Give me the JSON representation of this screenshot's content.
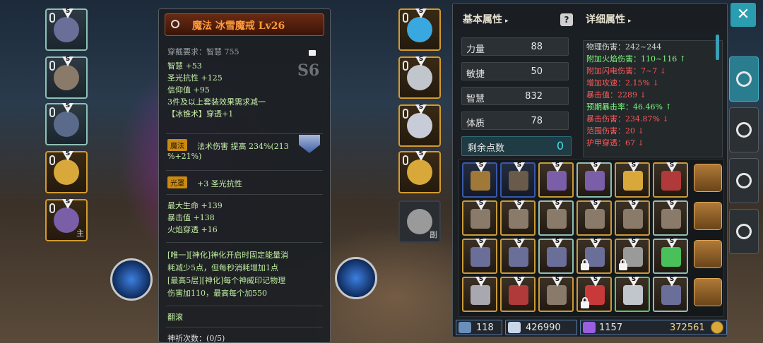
{
  "colors": {
    "accent": "#2a9db1",
    "item_green": "#c7f0a8",
    "stat_red": "#ff5a5a",
    "stat_green": "#7dff7d",
    "gold_tag": "#c98a10",
    "title_orange": "#ff9a3a"
  },
  "left_column": [
    {
      "icon": "helmet-icon",
      "rarity": "teal",
      "badge": "S"
    },
    {
      "icon": "armor-icon",
      "rarity": "teal",
      "badge": "S"
    },
    {
      "icon": "robe-icon",
      "rarity": "teal",
      "badge": "S"
    },
    {
      "icon": "ring-icon",
      "rarity": "gold",
      "badge": "S"
    },
    {
      "icon": "staff-icon",
      "rarity": "gold",
      "badge": "S",
      "sub": "主"
    }
  ],
  "tooltip": {
    "title": "魔法 冰雪魔戒 Lv26",
    "requirement": "穿戴要求：智慧 755",
    "grade": "S6",
    "base_lines": [
      "智慧 +53",
      "圣光抗性 +125",
      "信仰值 +95",
      "3件及以上套装效果需求减一",
      "【冰锥术】穿透+1"
    ],
    "tag_magic": "魔法",
    "magic_text": "法术伤害 提高 234%(213",
    "magic_text2": "%+21%)",
    "tag_light": "光罩",
    "light_text": "+3 圣光抗性",
    "bonus_lines": [
      "最大生命 +139",
      "暴击值 +138",
      "火焰穿透 +16"
    ],
    "unique_lines": [
      "[唯一][神化]神化开启时固定能量消",
      "耗减少5点，但每秒消耗增加1点",
      "[最高5层][神化]每个神威印记物理",
      "伤害加110，最高每个加550"
    ],
    "roll_label": "翻滚",
    "pray_label": "神祈次数：(0/5)"
  },
  "right_column": [
    {
      "icon": "necklace-icon",
      "badge": "S"
    },
    {
      "icon": "gloves-icon",
      "badge": "S"
    },
    {
      "icon": "boots-icon",
      "badge": "S"
    },
    {
      "icon": "ring-icon",
      "badge": "S"
    },
    {
      "icon": "sword-icon",
      "sub": "副"
    }
  ],
  "stats": {
    "basic_header": "基本属性",
    "detail_header": "详细属性",
    "attributes": [
      {
        "name": "力量",
        "value": "88"
      },
      {
        "name": "敏捷",
        "value": "50"
      },
      {
        "name": "智慧",
        "value": "832"
      },
      {
        "name": "体质",
        "value": "78"
      }
    ],
    "remaining_label": "剩余点数",
    "remaining_value": "0",
    "details": [
      {
        "text": "物理伤害：242~244",
        "color": "#d8d8d8"
      },
      {
        "text": "附加火焰伤害：110~116 ↑",
        "color": "#7dff7d"
      },
      {
        "text": "附加闪电伤害：7~7 ↓",
        "color": "#ff5a5a"
      },
      {
        "text": "增加攻速：2.15% ↓",
        "color": "#ff5a5a"
      },
      {
        "text": "暴击值：2289 ↓",
        "color": "#ff5a5a"
      },
      {
        "text": "预期暴击率：46.46% ↑",
        "color": "#7dff7d"
      },
      {
        "text": "暴击伤害：234.87% ↓",
        "color": "#ff5a5a"
      },
      {
        "text": "范围伤害：20 ↓",
        "color": "#ff5a5a"
      },
      {
        "text": "护甲穿透：67 ↓",
        "color": "#ff5a5a"
      }
    ]
  },
  "inventory": [
    {
      "icon": "backpack-icon",
      "frame": "blue",
      "badge": "S"
    },
    {
      "icon": "chest-armor-icon",
      "frame": "blue",
      "badge": "S"
    },
    {
      "icon": "staff-icon",
      "frame": "gold",
      "badge": "S"
    },
    {
      "icon": "staff-icon",
      "frame": "teal",
      "badge": "S"
    },
    {
      "icon": "ring-icon",
      "frame": "gold",
      "badge": "S"
    },
    {
      "icon": "spear-icon",
      "frame": "gold",
      "badge": "S"
    },
    {
      "icon": "armor-icon",
      "frame": "gold",
      "badge": "S"
    },
    {
      "icon": "armor-icon",
      "frame": "gold",
      "badge": "S"
    },
    {
      "icon": "armor-icon",
      "frame": "teal",
      "badge": "S"
    },
    {
      "icon": "armor-icon",
      "frame": "gold",
      "badge": "S"
    },
    {
      "icon": "armor-icon",
      "frame": "gold",
      "badge": "S"
    },
    {
      "icon": "armor-icon",
      "frame": "teal",
      "badge": "S"
    },
    {
      "icon": "helmet-icon",
      "frame": "gold",
      "badge": "S"
    },
    {
      "icon": "helmet-icon",
      "frame": "gold",
      "badge": "S"
    },
    {
      "icon": "helmet-icon",
      "frame": "teal",
      "badge": "S"
    },
    {
      "icon": "helmet-icon",
      "frame": "gold",
      "badge": "S",
      "locked": true
    },
    {
      "icon": "sword-icon",
      "frame": "gold",
      "badge": "S",
      "locked": true
    },
    {
      "icon": "gem-icon",
      "frame": "teal",
      "badge": "S"
    },
    {
      "icon": "dagger-icon",
      "frame": "gold",
      "badge": "S"
    },
    {
      "icon": "spear-icon",
      "frame": "gold",
      "badge": "S"
    },
    {
      "icon": "armor-icon",
      "frame": "gold",
      "badge": "S"
    },
    {
      "icon": "crown-icon",
      "frame": "gold",
      "badge": "S",
      "locked": true
    },
    {
      "icon": "gloves-icon",
      "frame": "green",
      "badge": "S"
    },
    {
      "icon": "helmet-icon",
      "frame": "teal",
      "badge": "S"
    }
  ],
  "bag_tabs": [
    "backpack-icon",
    "backpack-icon",
    "backpack-icon",
    "backpack-icon"
  ],
  "currency": {
    "weapon_count": "118",
    "diamond": "426990",
    "crystal": "1157",
    "gold": "372561"
  },
  "side_tabs": [
    {
      "icon": "helmet-icon",
      "active": true
    },
    {
      "icon": "weapons-icon",
      "active": false
    },
    {
      "icon": "target-icon",
      "active": false
    },
    {
      "icon": "settings-icon",
      "active": false
    }
  ],
  "close_label": "✕"
}
